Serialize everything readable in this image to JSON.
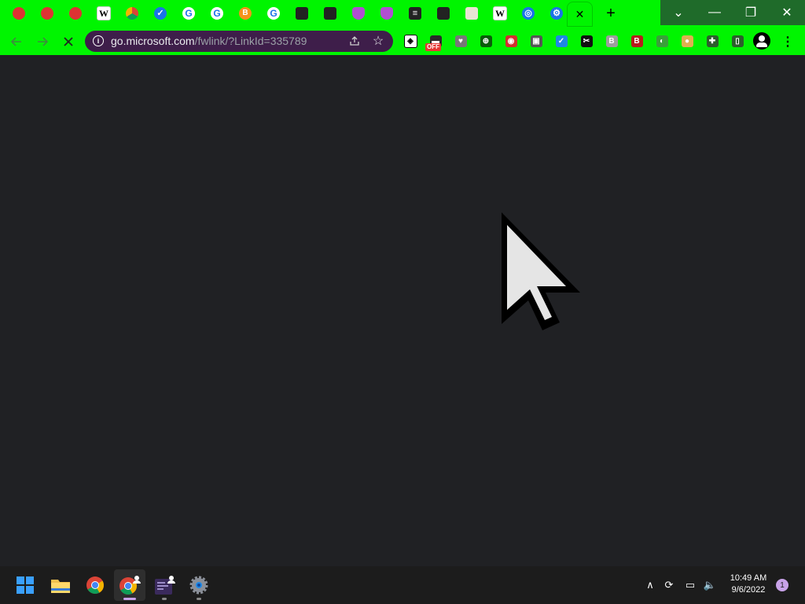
{
  "browser": {
    "tab_favicons": [
      {
        "icon": "red-hat-icon",
        "glyph": ""
      },
      {
        "icon": "red-hat-icon",
        "glyph": ""
      },
      {
        "icon": "red-hat-icon",
        "glyph": ""
      },
      {
        "icon": "wikipedia-icon",
        "glyph": "W"
      },
      {
        "icon": "chrome-icon",
        "glyph": ""
      },
      {
        "icon": "check-icon",
        "glyph": "✓"
      },
      {
        "icon": "google-translate-icon",
        "glyph": "G"
      },
      {
        "icon": "google-icon",
        "glyph": "G"
      },
      {
        "icon": "bitcoin-icon",
        "glyph": "B"
      },
      {
        "icon": "google-icon",
        "glyph": "G"
      },
      {
        "icon": "wallet-icon",
        "glyph": ""
      },
      {
        "icon": "wallet-icon",
        "glyph": ""
      },
      {
        "icon": "heart-icon",
        "glyph": ""
      },
      {
        "icon": "heart-icon",
        "glyph": ""
      },
      {
        "icon": "layers-icon",
        "glyph": "≡"
      },
      {
        "icon": "chat-icon",
        "glyph": ""
      },
      {
        "icon": "book-icon",
        "glyph": ""
      },
      {
        "icon": "wikipedia-icon",
        "glyph": "W"
      },
      {
        "icon": "target-icon",
        "glyph": "◎"
      },
      {
        "icon": "gear-icon",
        "glyph": "⚙"
      }
    ],
    "active_tab_close": "✕",
    "new_tab": "+",
    "window_controls": {
      "dropdown": "⌄",
      "minimize": "—",
      "restore": "❐",
      "close": "✕"
    },
    "address_bar": {
      "host": "go.microsoft.com",
      "path": "/fwlink/?LinkId=335789"
    },
    "extension_badge": "OFF",
    "extensions": [
      {
        "icon": "diamond-icon",
        "glyph": "◈",
        "color": "#ffffff"
      },
      {
        "icon": "switch-icon",
        "glyph": "▬",
        "color": "#2a2a2a"
      },
      {
        "icon": "heart-icon",
        "glyph": "♥",
        "color": "#777777"
      },
      {
        "icon": "globe-icon",
        "glyph": "⊕",
        "color": "#0a5c0a"
      },
      {
        "icon": "record-icon",
        "glyph": "◉",
        "color": "#d32f2f"
      },
      {
        "icon": "puzzle-block-icon",
        "glyph": "▣",
        "color": "#555555"
      },
      {
        "icon": "shield-check-icon",
        "glyph": "✓",
        "color": "#1e88e5"
      },
      {
        "icon": "tools-icon",
        "glyph": "✂",
        "color": "#111111"
      },
      {
        "icon": "letter-b-icon",
        "glyph": "B",
        "color": "#9e9e9e"
      },
      {
        "icon": "bitcoin-icon",
        "glyph": "B",
        "color": "#b71c1c"
      },
      {
        "icon": "eye-icon",
        "glyph": "◐",
        "color": "#3aa03a"
      },
      {
        "icon": "doge-icon",
        "glyph": "●",
        "color": "#e0b050"
      },
      {
        "icon": "extensions-puzzle-icon",
        "glyph": "✚",
        "color": "#2c5e2c"
      },
      {
        "icon": "sidebar-icon",
        "glyph": "▯",
        "color": "#2c5e2c"
      }
    ],
    "menu": "⋮"
  },
  "taskbar": {
    "clock_time": "10:49 AM",
    "clock_date": "9/6/2022",
    "notification_count": "1",
    "apps": [
      {
        "icon": "windows-start-icon"
      },
      {
        "icon": "file-explorer-icon"
      },
      {
        "icon": "chrome-icon"
      },
      {
        "icon": "chrome-profile-icon"
      },
      {
        "icon": "app-profile-icon"
      },
      {
        "icon": "settings-icon"
      }
    ],
    "tray": [
      {
        "icon": "chevron-up-icon",
        "glyph": "∧"
      },
      {
        "icon": "sync-icon",
        "glyph": "⟳"
      },
      {
        "icon": "network-icon",
        "glyph": "▭"
      },
      {
        "icon": "volume-icon",
        "glyph": "🔈"
      }
    ]
  },
  "colors": {
    "theme_green": "#00f500",
    "window_control_bg": "#1f6b2a",
    "omnibox_bg": "#3e1e4a",
    "page_bg": "#202124",
    "taskbar_bg": "#1c1c1c"
  }
}
